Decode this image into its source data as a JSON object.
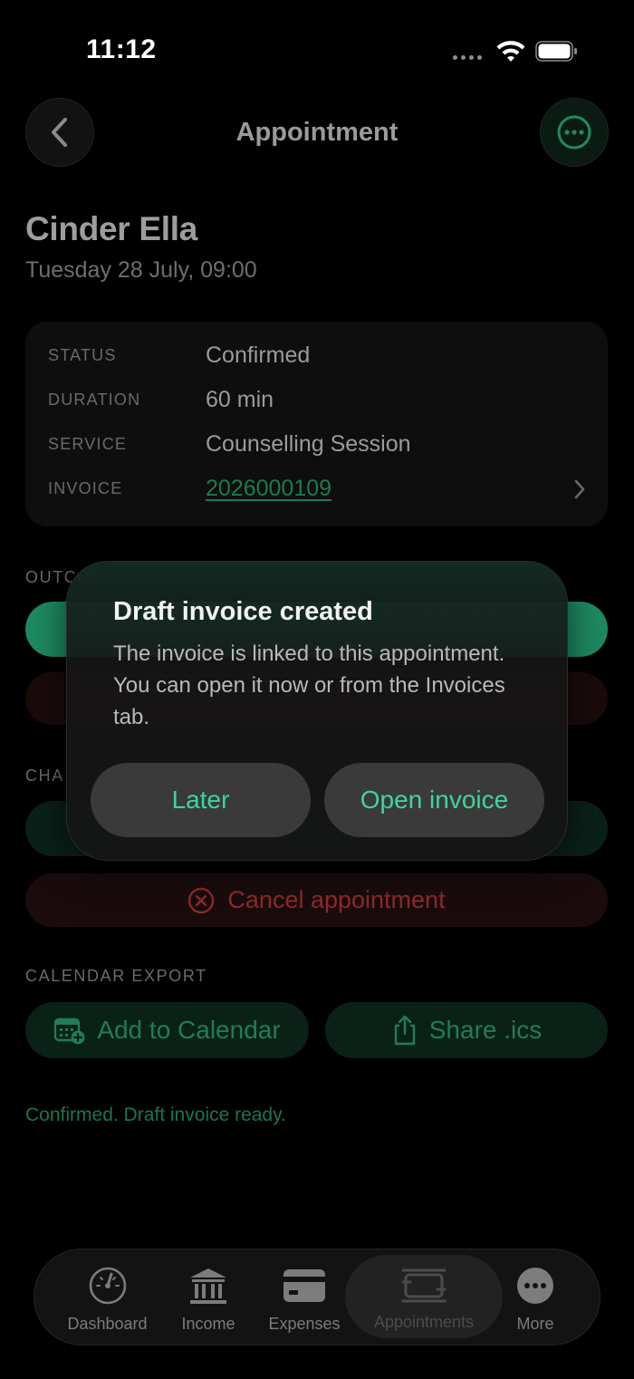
{
  "status_bar": {
    "time": "11:12"
  },
  "header": {
    "title": "Appointment"
  },
  "client": {
    "name": "Cinder Ella",
    "datetime": "Tuesday 28 July, 09:00"
  },
  "details": [
    {
      "label": "STATUS",
      "value": "Confirmed"
    },
    {
      "label": "DURATION",
      "value": "60 min"
    },
    {
      "label": "SERVICE",
      "value": "Counselling Session"
    },
    {
      "label": "INVOICE",
      "value": "2026000109"
    }
  ],
  "sections": {
    "outcome_label": "OUTCO",
    "change_label": "CHA",
    "calendar_export_label": "CALENDAR EXPORT"
  },
  "actions": {
    "cancel_label": "Cancel appointment"
  },
  "calendar_export": {
    "add_label": "Add to Calendar",
    "share_label": "Share .ics"
  },
  "status_message": "Confirmed. Draft invoice ready.",
  "dialog": {
    "title": "Draft invoice created",
    "body": "The invoice is linked to this appointment. You can open it now or from the Invoices tab.",
    "later_label": "Later",
    "open_label": "Open invoice"
  },
  "tabbar": {
    "items": [
      {
        "label": "Dashboard",
        "icon": "gauge-icon"
      },
      {
        "label": "Income",
        "icon": "bank-icon"
      },
      {
        "label": "Expenses",
        "icon": "card-icon"
      },
      {
        "label": "Appointments",
        "icon": "appointments-icon",
        "active": true
      },
      {
        "label": "More",
        "icon": "more-icon"
      }
    ]
  },
  "colors": {
    "accent": "#3fd59b",
    "link": "#1d7a54",
    "danger": "#8e2a2a",
    "background": "#000000"
  }
}
